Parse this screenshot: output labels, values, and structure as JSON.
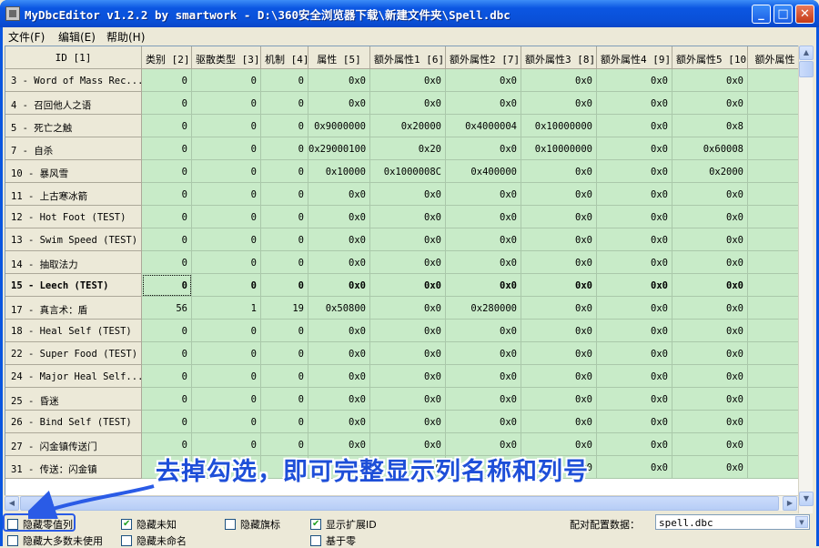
{
  "window": {
    "title": "MyDbcEditor v1.2.2 by smartwork - D:\\360安全浏览器下载\\新建文件夹\\Spell.dbc",
    "buttons": {
      "minimize": "_",
      "maximize": "□",
      "close": "✕"
    }
  },
  "menu": [
    {
      "label": "文件(F)"
    },
    {
      "label": "编辑(E)"
    },
    {
      "label": "帮助(H)"
    }
  ],
  "columns": [
    "ID [1]",
    "类别 [2]",
    "驱散类型 [3]",
    "机制 [4]",
    "属性 [5]",
    "额外属性1 [6]",
    "额外属性2 [7]",
    "额外属性3 [8]",
    "额外属性4 [9]",
    "额外属性5 [10]",
    "额外属性"
  ],
  "rows": [
    {
      "id": "3 - Word of Mass Rec...",
      "values": [
        "0",
        "0",
        "0",
        "0x0",
        "0x0",
        "0x0",
        "0x0",
        "0x0",
        "0x0"
      ]
    },
    {
      "id": "4 - 召回他人之语",
      "values": [
        "0",
        "0",
        "0",
        "0x0",
        "0x0",
        "0x0",
        "0x0",
        "0x0",
        "0x0"
      ]
    },
    {
      "id": "5 - 死亡之触",
      "values": [
        "0",
        "0",
        "0",
        "0x9000000",
        "0x20000",
        "0x4000004",
        "0x10000000",
        "0x0",
        "0x8"
      ]
    },
    {
      "id": "7 - 自杀",
      "values": [
        "0",
        "0",
        "0",
        "0x29000100",
        "0x20",
        "0x0",
        "0x10000000",
        "0x0",
        "0x60008"
      ]
    },
    {
      "id": "10 - 暴风雪",
      "values": [
        "0",
        "0",
        "0",
        "0x10000",
        "0x1000008C",
        "0x400000",
        "0x0",
        "0x0",
        "0x2000"
      ]
    },
    {
      "id": "11 - 上古寒冰箭",
      "values": [
        "0",
        "0",
        "0",
        "0x0",
        "0x0",
        "0x0",
        "0x0",
        "0x0",
        "0x0"
      ]
    },
    {
      "id": "12 - Hot Foot (TEST)",
      "values": [
        "0",
        "0",
        "0",
        "0x0",
        "0x0",
        "0x0",
        "0x0",
        "0x0",
        "0x0"
      ]
    },
    {
      "id": "13 - Swim Speed (TEST)",
      "values": [
        "0",
        "0",
        "0",
        "0x0",
        "0x0",
        "0x0",
        "0x0",
        "0x0",
        "0x0"
      ]
    },
    {
      "id": "14 - 抽取法力",
      "values": [
        "0",
        "0",
        "0",
        "0x0",
        "0x0",
        "0x0",
        "0x0",
        "0x0",
        "0x0"
      ]
    },
    {
      "id": "15 - Leech (TEST)",
      "values": [
        "0",
        "0",
        "0",
        "0x0",
        "0x0",
        "0x0",
        "0x0",
        "0x0",
        "0x0"
      ],
      "selected": true
    },
    {
      "id": "17 - 真言术：盾",
      "values": [
        "56",
        "1",
        "19",
        "0x50800",
        "0x0",
        "0x280000",
        "0x0",
        "0x0",
        "0x0"
      ]
    },
    {
      "id": "18 - Heal Self (TEST)",
      "values": [
        "0",
        "0",
        "0",
        "0x0",
        "0x0",
        "0x0",
        "0x0",
        "0x0",
        "0x0"
      ]
    },
    {
      "id": "22 - Super Food (TEST)",
      "values": [
        "0",
        "0",
        "0",
        "0x0",
        "0x0",
        "0x0",
        "0x0",
        "0x0",
        "0x0"
      ]
    },
    {
      "id": "24 - Major Heal Self...",
      "values": [
        "0",
        "0",
        "0",
        "0x0",
        "0x0",
        "0x0",
        "0x0",
        "0x0",
        "0x0"
      ]
    },
    {
      "id": "25 - 昏迷",
      "values": [
        "0",
        "0",
        "0",
        "0x0",
        "0x0",
        "0x0",
        "0x0",
        "0x0",
        "0x0"
      ]
    },
    {
      "id": "26 - Bind Self (TEST)",
      "values": [
        "0",
        "0",
        "0",
        "0x0",
        "0x0",
        "0x0",
        "0x0",
        "0x0",
        "0x0"
      ]
    },
    {
      "id": "27 - 闪金镇传送门",
      "values": [
        "0",
        "0",
        "0",
        "0x0",
        "0x0",
        "0x0",
        "0x0",
        "0x0",
        "0x0"
      ]
    },
    {
      "id": "31 - 传送：闪金镇",
      "values": [
        "0",
        "0",
        "0",
        "0x0",
        "0x0",
        "0x0",
        "0x0",
        "0x0",
        "0x0"
      ]
    }
  ],
  "annotation": "去掉勾选，即可完整显示列名称和列号",
  "options": [
    {
      "label": "隐藏零值列",
      "checked": false
    },
    {
      "label": "隐藏大多数未使用",
      "checked": false
    },
    {
      "label": "隐藏未知",
      "checked": true
    },
    {
      "label": "隐藏未命名",
      "checked": false
    },
    {
      "label": "隐藏旗标",
      "checked": false
    },
    {
      "label": "显示扩展ID",
      "checked": true
    },
    {
      "label": "基于零",
      "checked": false
    }
  ],
  "config": {
    "label": "配对配置数据：",
    "value": "spell.dbc"
  },
  "colors": {
    "cell": "#c8ebc8",
    "annotation": "#1e4fd8",
    "titlebar": "#0b56e2"
  }
}
